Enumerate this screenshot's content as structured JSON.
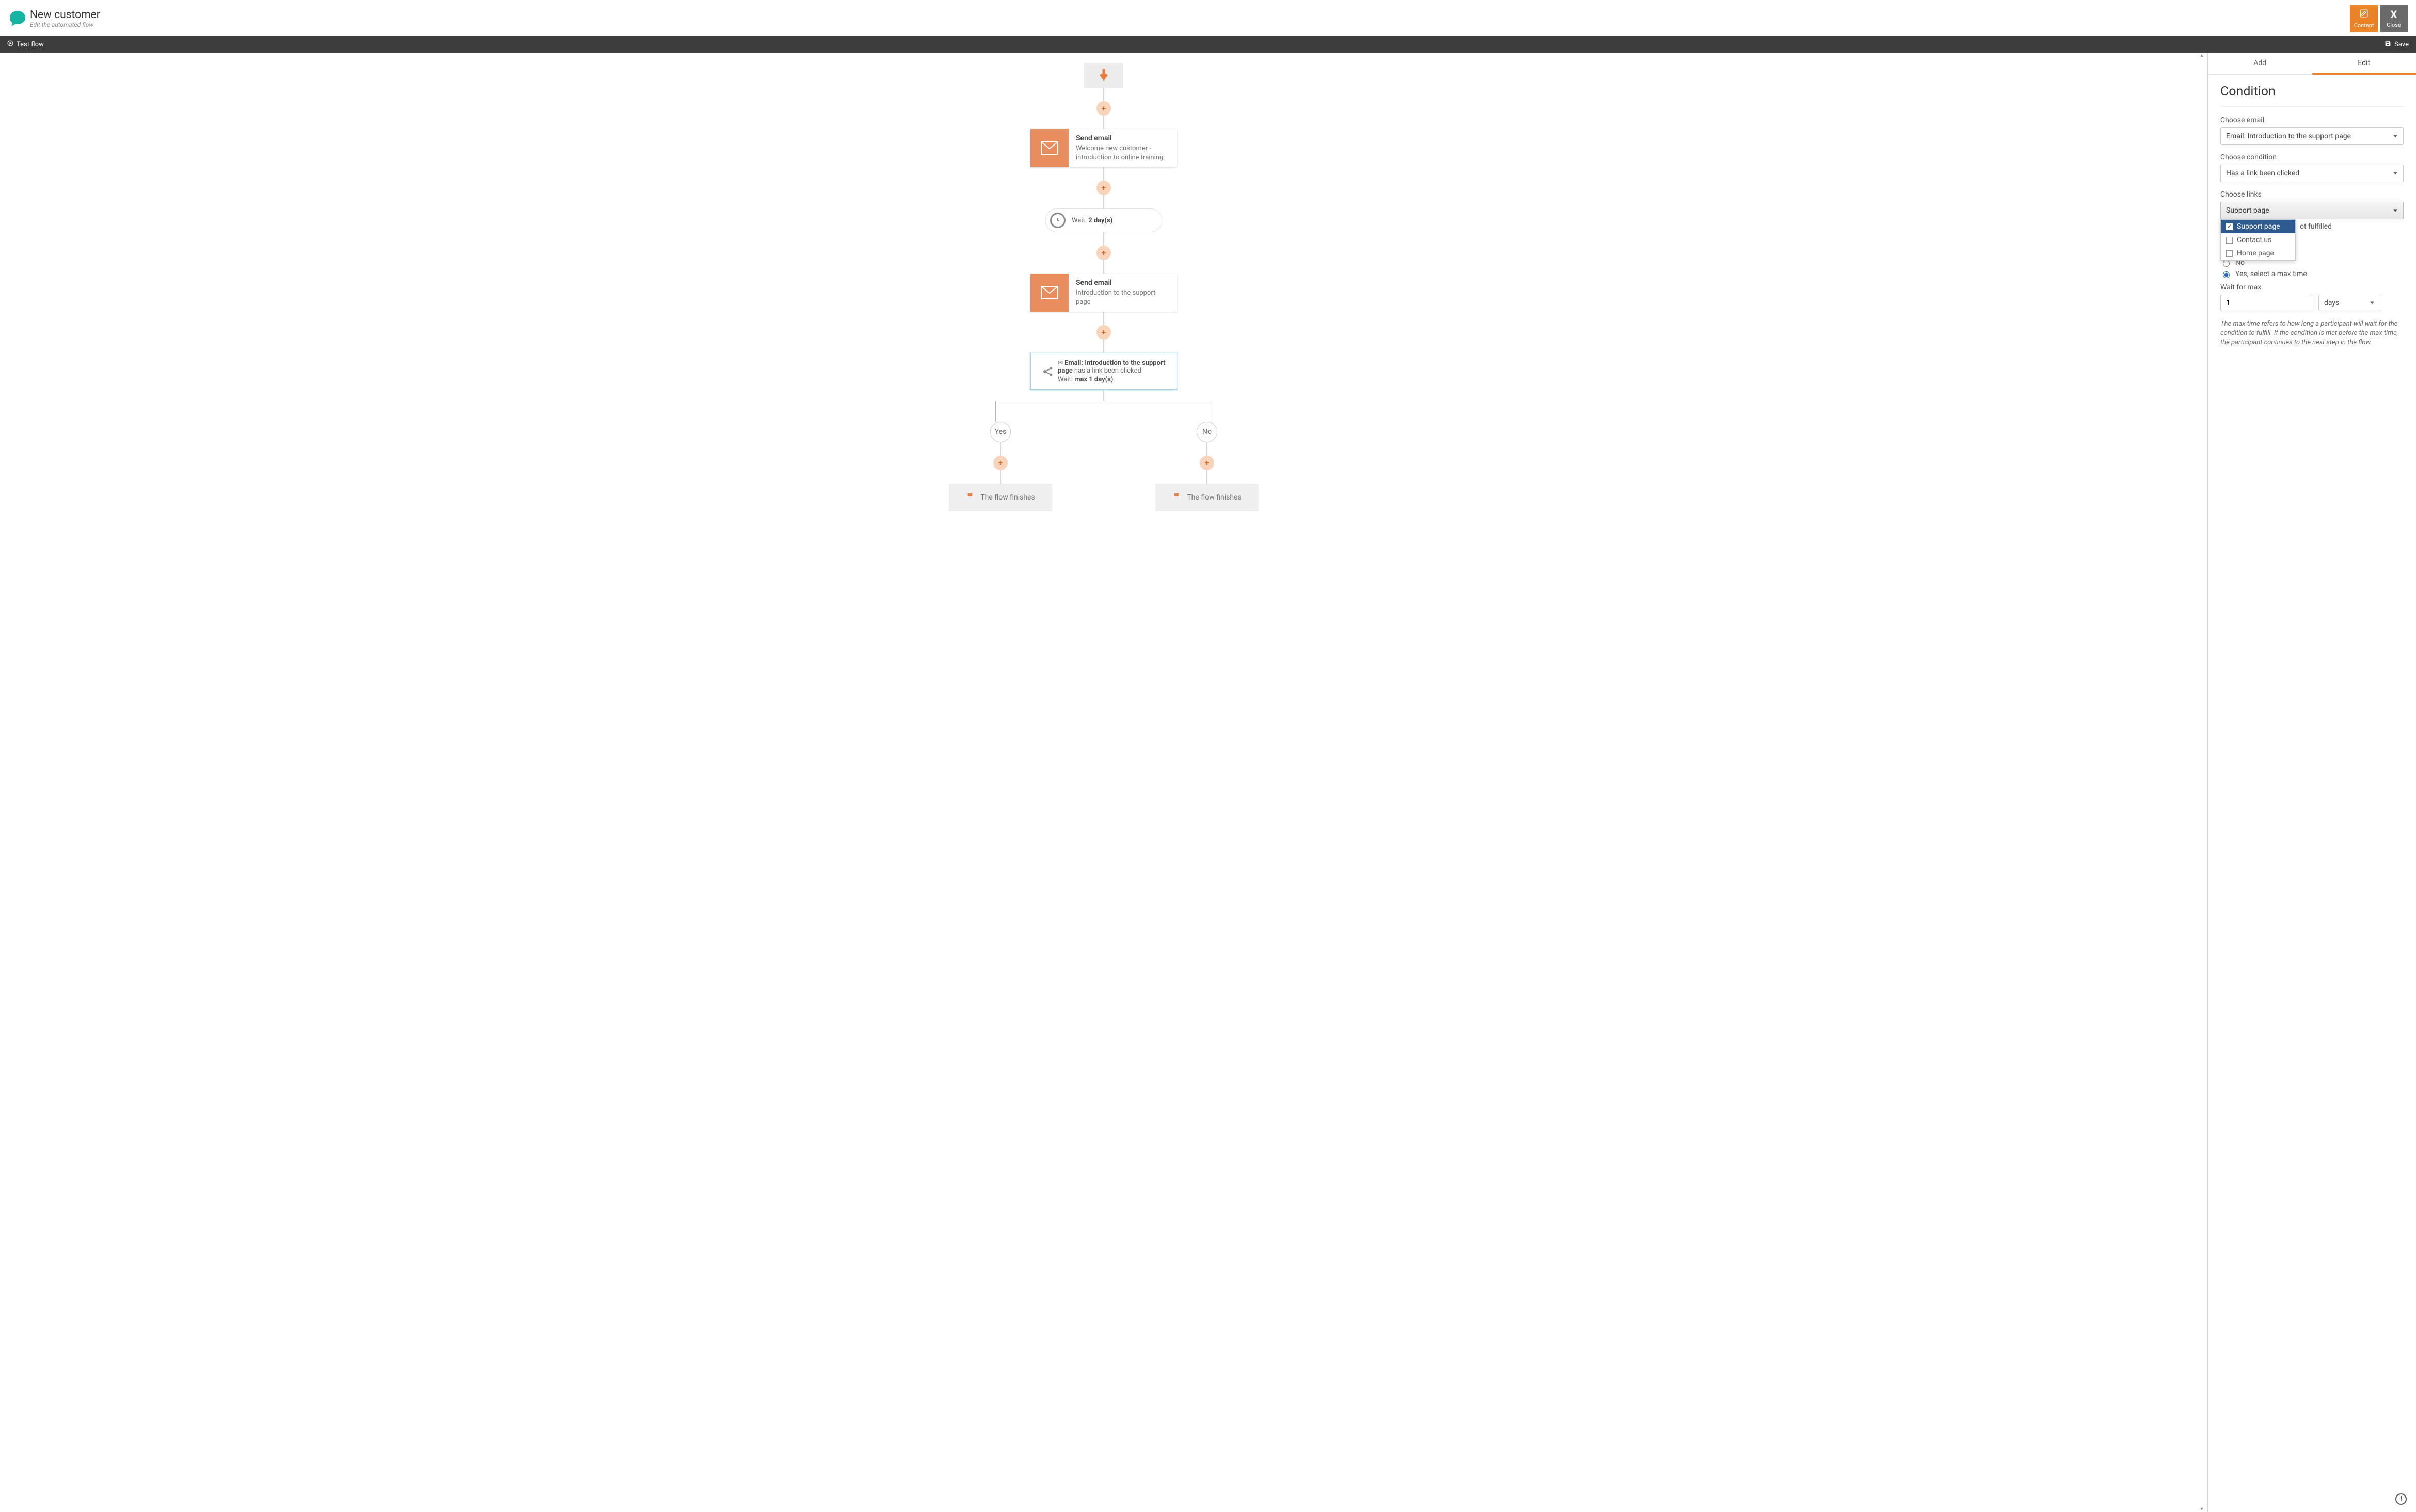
{
  "header": {
    "title": "New customer",
    "subtitle": "Edit the automated flow",
    "content_btn": "Content",
    "close_btn": "Close"
  },
  "toolbar": {
    "test": "Test flow",
    "save": "Save"
  },
  "flow": {
    "email1": {
      "title": "Send email",
      "desc": "Welcome new customer - introduction to online training"
    },
    "wait1": {
      "prefix": "Wait: ",
      "value": "2 day(s)"
    },
    "email2": {
      "title": "Send email",
      "desc": "Introduction to the support page"
    },
    "cond": {
      "line1_bold": "Email: Introduction to the support page",
      "line1_rest": " has a link been clicked",
      "line2_prefix": "Wait: ",
      "line2_bold": "max 1 day(s)"
    },
    "yes": "Yes",
    "no": "No",
    "finish": "The flow finishes"
  },
  "sidebar": {
    "tabs": {
      "add": "Add",
      "edit": "Edit"
    },
    "heading": "Condition",
    "email_label": "Choose email",
    "email_value": "Email: Introduction to the support page",
    "cond_label": "Choose condition",
    "cond_value": "Has a link been clicked",
    "links_label": "Choose links",
    "links_value": "Support page",
    "links_options": [
      "Support page",
      "Contact us",
      "Home page"
    ],
    "peek_text": "ot fulfilled",
    "radio_no": "No",
    "radio_yes": "Yes, select a max time",
    "wait_label": "Wait for max",
    "wait_value": "1",
    "wait_unit": "days",
    "hint": "The max time refers to how long a participant will wait for the condition to fulfill. If the condition is met before the max time, the participant continues to the next step in the flow."
  }
}
